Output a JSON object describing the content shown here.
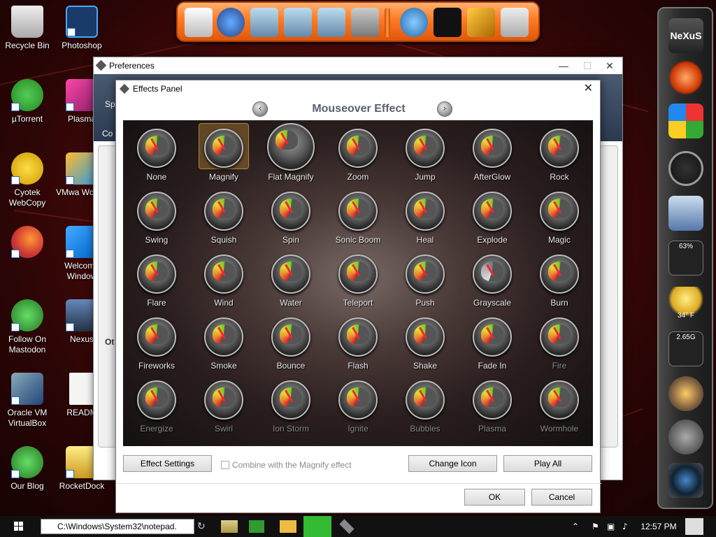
{
  "desktop_icons": [
    {
      "label": "Recycle Bin",
      "icon": "recycle-bin-icon",
      "color": "#d8d8d8"
    },
    {
      "label": "Photoshop",
      "icon": "photoshop-icon",
      "color": "#1a3a6a"
    },
    {
      "label": "µTorrent",
      "icon": "utorrent-icon",
      "color": "#3aa23a"
    },
    {
      "label": "Plasma",
      "icon": "plasma-icon",
      "color": "#c02a7a"
    },
    {
      "label": "Cyotek WebCopy",
      "icon": "webcopy-icon",
      "color": "#e8c020"
    },
    {
      "label": "VMwa Workst",
      "icon": "vmware-icon",
      "color": "#f0a020"
    },
    {
      "label": "",
      "icon": "firefox-icon",
      "color": "#e86a1a"
    },
    {
      "label": "Welcome Window",
      "icon": "windows-icon",
      "color": "#1a8ae8"
    },
    {
      "label": "Follow On Mastodon",
      "icon": "mastodon-labsysos-icon",
      "color": "#2aa03a"
    },
    {
      "label": "Nexus",
      "icon": "nexus-icon",
      "color": "#3a5a9a"
    },
    {
      "label": "Oracle VM VirtualBox",
      "icon": "virtualbox-icon",
      "color": "#2a5aa0"
    },
    {
      "label": "READM",
      "icon": "readme-file-icon",
      "color": "#f0f0f0"
    },
    {
      "label": "Our Blog",
      "icon": "blog-labsysos-icon",
      "color": "#2aa03a"
    },
    {
      "label": "RocketDock",
      "icon": "rocketdock-icon",
      "color": "#e8c040"
    }
  ],
  "preferences": {
    "title": "Preferences",
    "minimize": "—",
    "maximize": "☐",
    "close": "✕",
    "partial_labels": [
      "Sp",
      "Co",
      "Ot"
    ]
  },
  "effects_panel": {
    "title": "Effects Panel",
    "close": "✕",
    "heading": "Mouseover Effect",
    "prev_arrow": "‹",
    "next_arrow": "›",
    "effects": [
      {
        "label": "None"
      },
      {
        "label": "Magnify",
        "selected": true
      },
      {
        "label": "Flat Magnify"
      },
      {
        "label": "Zoom"
      },
      {
        "label": "Jump"
      },
      {
        "label": "AfterGlow"
      },
      {
        "label": "Rock"
      },
      {
        "label": "Swing"
      },
      {
        "label": "Squish"
      },
      {
        "label": "Spin"
      },
      {
        "label": "Sonic Boom"
      },
      {
        "label": "Heal"
      },
      {
        "label": "Explode"
      },
      {
        "label": "Magic"
      },
      {
        "label": "Flare"
      },
      {
        "label": "Wind"
      },
      {
        "label": "Water"
      },
      {
        "label": "Teleport"
      },
      {
        "label": "Push"
      },
      {
        "label": "Grayscale"
      },
      {
        "label": "Burn"
      },
      {
        "label": "Fireworks"
      },
      {
        "label": "Smoke"
      },
      {
        "label": "Bounce"
      },
      {
        "label": "Flash"
      },
      {
        "label": "Shake"
      },
      {
        "label": "Fade In"
      },
      {
        "label": "Fire",
        "disabled": true
      },
      {
        "label": "Energize",
        "disabled": true
      },
      {
        "label": "Swirl",
        "disabled": true
      },
      {
        "label": "Ion Storm",
        "disabled": true
      },
      {
        "label": "Ignite",
        "disabled": true
      },
      {
        "label": "Bubbles",
        "disabled": true
      },
      {
        "label": "Plasma",
        "disabled": true
      },
      {
        "label": "Wormhole",
        "disabled": true
      }
    ],
    "effect_settings_label": "Effect Settings",
    "combine_label": "Combine with the Magnify effect",
    "change_icon_label": "Change Icon",
    "play_all_label": "Play All",
    "ok_label": "OK",
    "cancel_label": "Cancel"
  },
  "right_dock": {
    "logo": "NeXuS",
    "cpu_percent": "63%",
    "weather_temp": "34° F",
    "memory": "2.65G"
  },
  "taskbar": {
    "command_text": "C:\\Windows\\System32\\notepad.",
    "clock": "12:57 PM"
  }
}
